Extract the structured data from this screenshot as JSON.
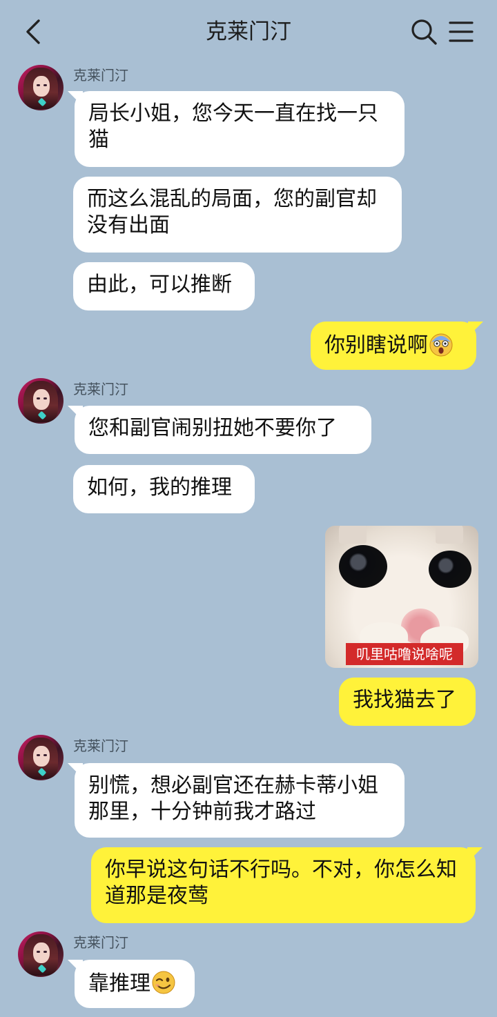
{
  "header": {
    "title": "克莱门汀"
  },
  "messages": [
    {
      "sender": "克莱门汀",
      "side": "left",
      "text": "局长小姐，您今天一直在找一只猫"
    },
    {
      "side": "left",
      "text": "而这么混乱的局面，您的副官却没有出面"
    },
    {
      "side": "left",
      "text": "由此，可以推断"
    },
    {
      "side": "right",
      "text": "你别瞎说啊",
      "emoji": "scream-emoji"
    },
    {
      "sender": "克莱门汀",
      "side": "left",
      "text": "您和副官闹别扭她不要你了"
    },
    {
      "side": "left",
      "text": "如何，我的推理"
    },
    {
      "side": "right",
      "type": "sticker",
      "sticker_caption": "叽里咕噜说啥呢",
      "sticker_icon": "white-kitten-closeup"
    },
    {
      "side": "right",
      "text": "我找猫去了"
    },
    {
      "sender": "克莱门汀",
      "side": "left",
      "text": "别慌，想必副官还在赫卡蒂小姐那里，十分钟前我才路过"
    },
    {
      "side": "right",
      "text": "你早说这句话不行吗。不对，你怎么知道那是夜莺"
    },
    {
      "sender": "克莱门汀",
      "side": "left",
      "text": "靠推理",
      "emoji": "wink-emoji"
    }
  ],
  "colors": {
    "background": "#a9bfd3",
    "bubble_left": "#ffffff",
    "bubble_right": "#fff23a"
  },
  "icons": {
    "back": "back-chevron-icon",
    "search": "search-icon",
    "menu": "menu-icon"
  }
}
